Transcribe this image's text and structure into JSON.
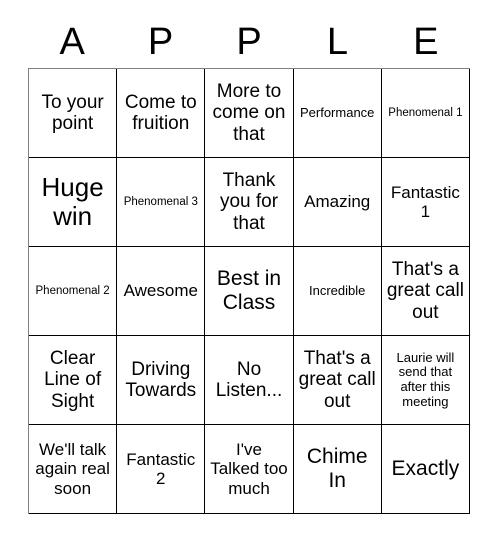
{
  "card": {
    "title_letters": [
      "A",
      "P",
      "P",
      "L",
      "E"
    ],
    "grid_line_color": "#000000",
    "text_color": "#000000",
    "background_color": "#ffffff",
    "rows": [
      [
        {
          "text": "To your point",
          "size": "fs-l"
        },
        {
          "text": "Come to fruition",
          "size": "fs-l"
        },
        {
          "text": "More to come on that",
          "size": "fs-l"
        },
        {
          "text": "Performance",
          "size": "fs-s"
        },
        {
          "text": "Phenomenal 1",
          "size": "fs-xs"
        }
      ],
      [
        {
          "text": "Huge win",
          "size": "fs-xxl"
        },
        {
          "text": "Phenomenal 3",
          "size": "fs-xs"
        },
        {
          "text": "Thank you for that",
          "size": "fs-l"
        },
        {
          "text": "Amazing",
          "size": "fs-m"
        },
        {
          "text": "Fantastic 1",
          "size": "fs-m"
        }
      ],
      [
        {
          "text": "Phenomenal 2",
          "size": "fs-xs"
        },
        {
          "text": "Awesome",
          "size": "fs-m"
        },
        {
          "text": "Best in Class",
          "size": "fs-xl"
        },
        {
          "text": "Incredible",
          "size": "fs-s"
        },
        {
          "text": "That's a great call out",
          "size": "fs-l"
        }
      ],
      [
        {
          "text": "Clear Line of Sight",
          "size": "fs-l"
        },
        {
          "text": "Driving Towards",
          "size": "fs-l"
        },
        {
          "text": "No Listen...",
          "size": "fs-l"
        },
        {
          "text": "That's a great call out",
          "size": "fs-l"
        },
        {
          "text": "Laurie will send that after this meeting",
          "size": "fs-s"
        }
      ],
      [
        {
          "text": "We'll talk again real soon",
          "size": "fs-m"
        },
        {
          "text": "Fantastic 2",
          "size": "fs-m"
        },
        {
          "text": "I've Talked too much",
          "size": "fs-m"
        },
        {
          "text": "Chime In",
          "size": "fs-xl"
        },
        {
          "text": "Exactly",
          "size": "fs-xl"
        }
      ]
    ]
  }
}
